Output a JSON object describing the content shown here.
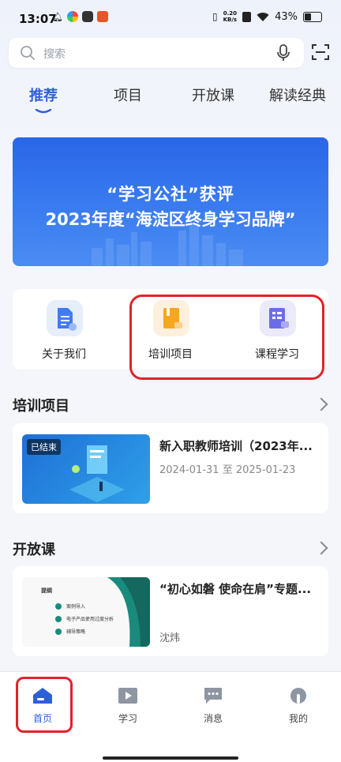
{
  "status_bar": {
    "time": "13:07",
    "network_speed_value": "0.20",
    "network_speed_unit": "KB/s",
    "battery": "43%"
  },
  "search": {
    "placeholder": "搜索"
  },
  "tabs": [
    {
      "label": "推荐",
      "active": true
    },
    {
      "label": "项目"
    },
    {
      "label": "开放课"
    },
    {
      "label": "解读经典"
    }
  ],
  "banner": {
    "line1": "“学习公社”获评",
    "line2": "2023年度“海淀区终身学习品牌”"
  },
  "quick_entries": [
    {
      "label": "关于我们",
      "icon": "document-icon",
      "color": "#3f7cf0"
    },
    {
      "label": "培训项目",
      "icon": "training-book-icon",
      "color": "#f5a623"
    },
    {
      "label": "课程学习",
      "icon": "course-icon",
      "color": "#6b6de8"
    }
  ],
  "training_section": {
    "title": "培训项目",
    "items": [
      {
        "badge": "已结束",
        "title": "新入职教师培训（2023年...",
        "date_start": "2024-01-31",
        "date_sep": "至",
        "date_end": "2025-01-23"
      }
    ]
  },
  "open_course_section": {
    "title": "开放课",
    "items": [
      {
        "title": "“初心如磐 使命在肩”专题...",
        "author": "沈炜",
        "thumb": {
          "heading": "提纲",
          "points": [
            "案例导入",
            "电子产品使用过度分析",
            "辅导策略"
          ]
        }
      }
    ]
  },
  "bottom_nav": [
    {
      "label": "首页",
      "icon": "home-icon",
      "active": true
    },
    {
      "label": "学习",
      "icon": "video-play-icon"
    },
    {
      "label": "消息",
      "icon": "message-icon"
    },
    {
      "label": "我的",
      "icon": "profile-icon"
    }
  ],
  "colors": {
    "accent": "#2f5fd8",
    "highlight_box": "#e0232b",
    "banner_blue": "#2a66e8"
  }
}
